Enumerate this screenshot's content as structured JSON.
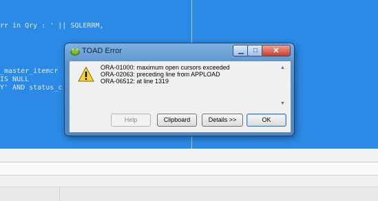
{
  "editor": {
    "code_lines": [
      "rr in Qry : ' || SQLERRM,",
      "_master_itemcr",
      "IS NULL",
      "Y' AND status_c"
    ]
  },
  "dialog": {
    "title": "TOAD Error",
    "titlebar_icons": {
      "app": "toad-app-icon",
      "minimize": "minimize-icon",
      "maximize": "maximize-icon",
      "close": "close-icon"
    },
    "message_lines": [
      "ORA-01000: maximum open cursors exceeded",
      "ORA-02063: preceding line from APPLOAD",
      "ORA-06512: at line 1319"
    ],
    "buttons": {
      "help": "Help",
      "clipboard": "Clipboard",
      "details": "Details >>",
      "ok": "OK"
    }
  },
  "colors": {
    "editor_background": "#2a8ae6",
    "dialog_frame": "#5b93cf",
    "close_button": "#c8412b"
  }
}
